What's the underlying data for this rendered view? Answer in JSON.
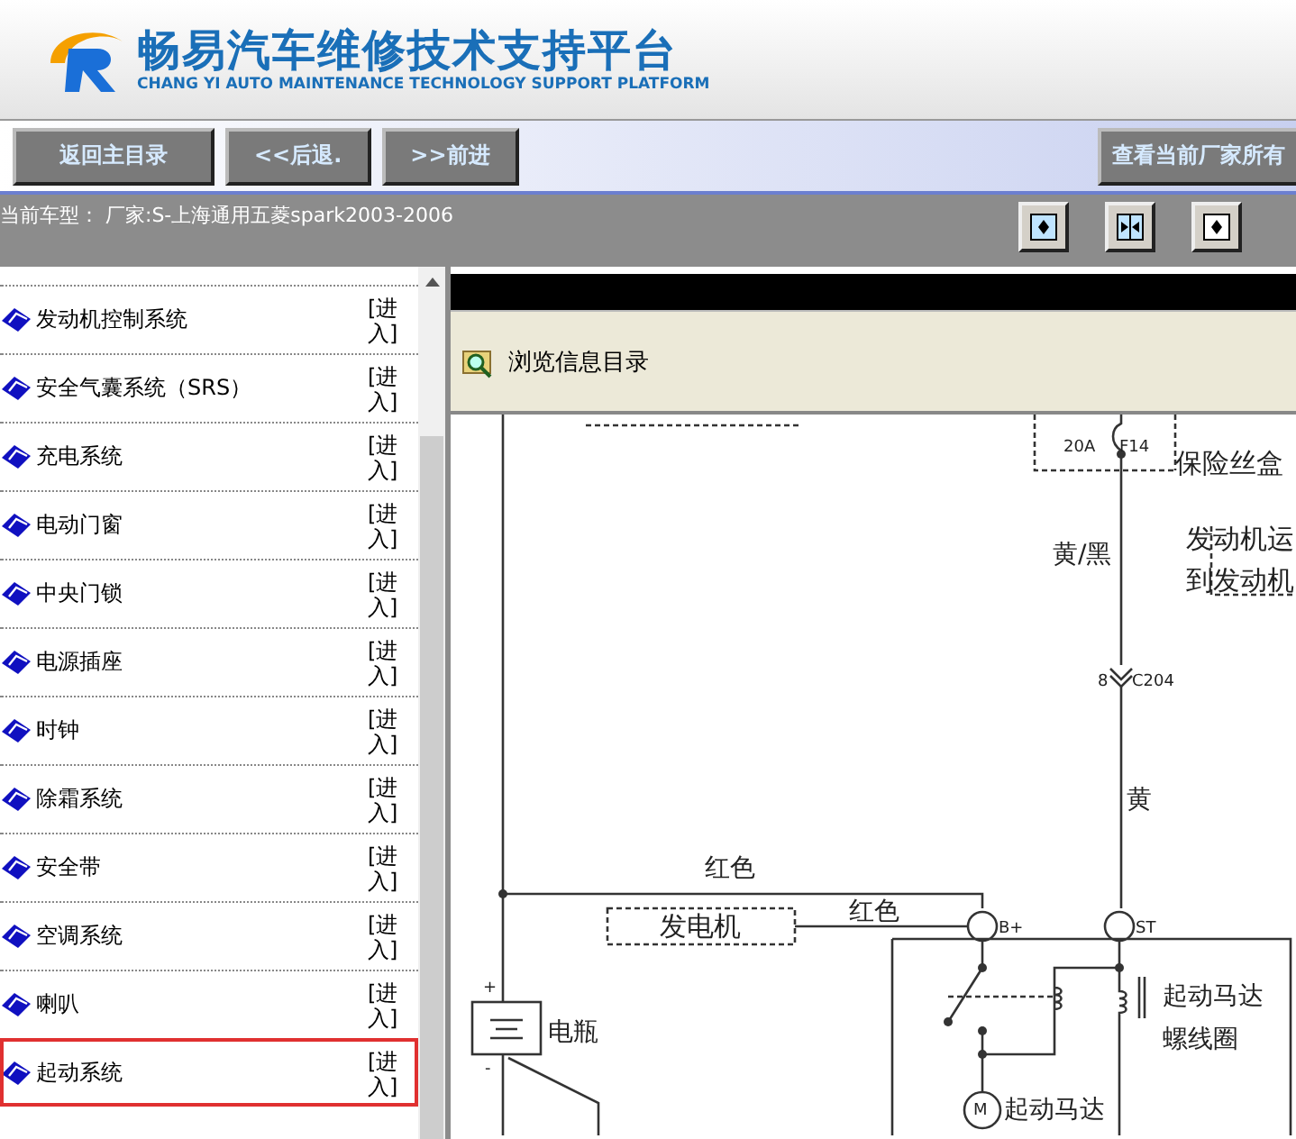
{
  "header": {
    "title": "畅易汽车维修技术支持平台",
    "subtitle": "CHANG YI AUTO MAINTENANCE TECHNOLOGY SUPPORT PLATFORM"
  },
  "nav_buttons": [
    "返回主目录",
    "<<后退.",
    ">>前进"
  ],
  "right_button": "查看当前厂家所有",
  "vehicle_info": "当前车型： 厂家:S-上海通用五菱spark2003-2006",
  "systems": [
    {
      "name": "发动机控制系统",
      "link": "[进入]",
      "selected": false
    },
    {
      "name": "安全气囊系统（SRS）",
      "link": "[进入]",
      "selected": false
    },
    {
      "name": "充电系统",
      "link": "[进入]",
      "selected": false
    },
    {
      "name": "电动门窗",
      "link": "[进入]",
      "selected": false
    },
    {
      "name": "中央门锁",
      "link": "[进入]",
      "selected": false
    },
    {
      "name": "电源插座",
      "link": "[进入]",
      "selected": false
    },
    {
      "name": "时钟",
      "link": "[进入]",
      "selected": false
    },
    {
      "name": "除霜系统",
      "link": "[进入]",
      "selected": false
    },
    {
      "name": "安全带",
      "link": "[进入]",
      "selected": false
    },
    {
      "name": "空调系统",
      "link": "[进入]",
      "selected": false
    },
    {
      "name": "喇叭",
      "link": "[进入]",
      "selected": false
    },
    {
      "name": "起动系统",
      "link": "[进入]",
      "selected": true
    }
  ],
  "panel": {
    "title": "浏览信息目录"
  },
  "diagram": {
    "labels": [
      "20A",
      "F14",
      "保险丝盒",
      "黄/黑",
      "发动机运",
      "到发动机",
      "8",
      "C204",
      "黄",
      "红色",
      "红色",
      "发电机",
      "B+",
      "ST",
      "电瓶",
      "+",
      "-",
      "起动马达",
      "螺线圈",
      "M",
      "起动马达"
    ]
  }
}
